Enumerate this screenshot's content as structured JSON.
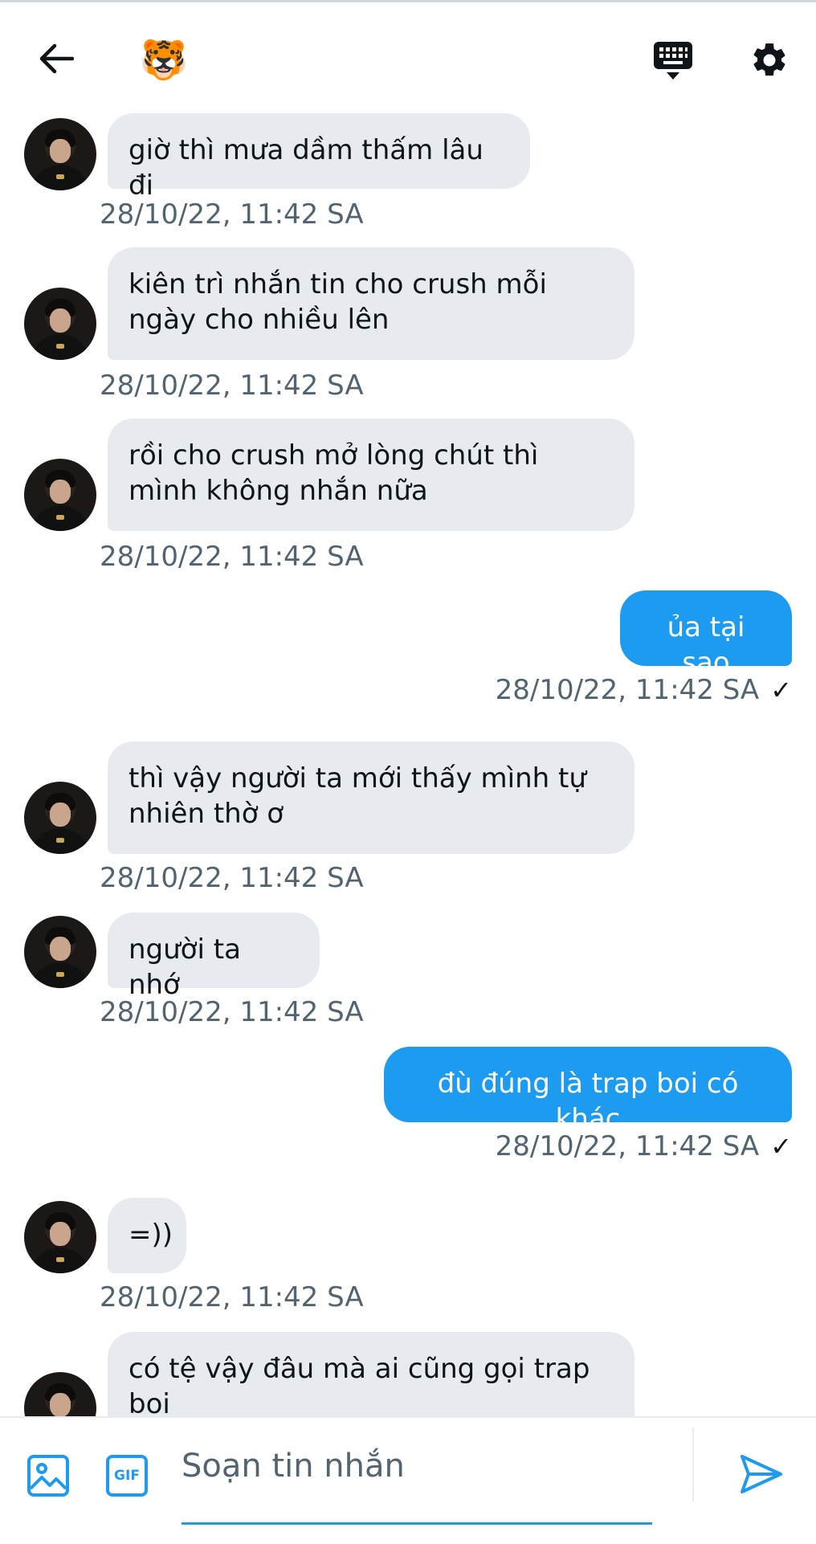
{
  "header": {
    "avatar_emoji": "🐯",
    "icons": [
      "back-arrow-icon",
      "keyboard-icon",
      "gear-icon"
    ]
  },
  "messages": [
    {
      "dir": "in",
      "text": "giờ thì mưa dầm thấm lâu đi",
      "time": "28/10/22, 11:42 SA"
    },
    {
      "dir": "in",
      "text": "kiên trì nhắn tin cho crush mỗi ngày cho nhiều lên",
      "time": "28/10/22, 11:42 SA"
    },
    {
      "dir": "in",
      "text": "rồi cho crush mở lòng chút thì mình không nhắn nữa",
      "time": "28/10/22, 11:42 SA"
    },
    {
      "dir": "out",
      "text": "ủa tại sao",
      "time": "28/10/22, 11:42 SA",
      "status": "✓"
    },
    {
      "dir": "in",
      "text": "thì vậy người ta mới thấy mình tự nhiên thờ ơ",
      "time": "28/10/22, 11:42 SA"
    },
    {
      "dir": "in",
      "text": "người ta nhớ",
      "time": "28/10/22, 11:42 SA"
    },
    {
      "dir": "out",
      "text": "đù đúng là trap boi có khác",
      "time": "28/10/22, 11:42 SA",
      "status": "✓"
    },
    {
      "dir": "in",
      "text": "=))",
      "time": "28/10/22, 11:42 SA"
    },
    {
      "dir": "in",
      "text": "có tệ vậy đâu mà ai cũng gọi trap boi",
      "time": ""
    }
  ],
  "composer": {
    "placeholder": "Soạn tin nhắn",
    "gif_label": "GIF",
    "icons": [
      "image-icon",
      "gif-icon",
      "send-icon"
    ]
  },
  "colors": {
    "accent": "#1d9bf0",
    "incoming_bubble": "#e7ebef",
    "timestamp": "#536471",
    "text": "#0f1419"
  }
}
